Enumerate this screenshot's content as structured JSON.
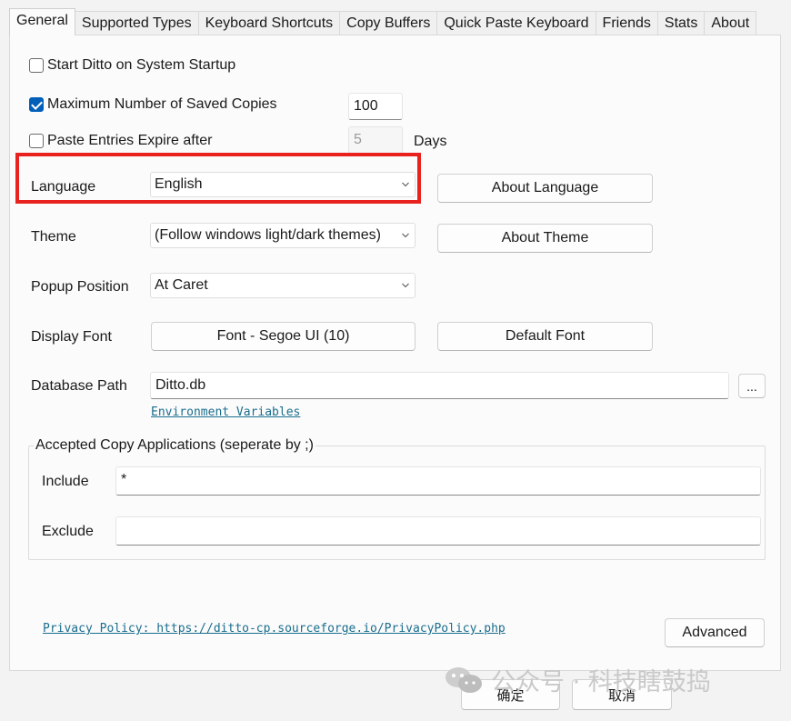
{
  "tabs": [
    {
      "label": "General",
      "active": true
    },
    {
      "label": "Supported Types"
    },
    {
      "label": "Keyboard Shortcuts"
    },
    {
      "label": "Copy Buffers"
    },
    {
      "label": "Quick Paste Keyboard"
    },
    {
      "label": "Friends"
    },
    {
      "label": "Stats"
    },
    {
      "label": "About"
    }
  ],
  "general": {
    "start_on_startup": {
      "label": "Start Ditto on System Startup",
      "checked": false
    },
    "max_saved": {
      "label": "Maximum Number of Saved Copies",
      "checked": true,
      "value": "100"
    },
    "expire": {
      "label": "Paste Entries Expire after",
      "checked": false,
      "value": "5",
      "unit": "Days"
    },
    "language": {
      "label": "Language",
      "value": "English",
      "about_button": "About Language"
    },
    "theme": {
      "label": "Theme",
      "value": "(Follow windows light/dark themes)",
      "about_button": "About Theme"
    },
    "popup_position": {
      "label": "Popup Position",
      "value": "At Caret"
    },
    "display_font": {
      "label": "Display Font",
      "font_button": "Font - Segoe UI (10)",
      "default_button": "Default Font"
    },
    "database_path": {
      "label": "Database Path",
      "value": "Ditto.db",
      "browse_button": "...",
      "env_link": "Environment Variables"
    },
    "accepted_apps": {
      "title": "Accepted Copy Applications (seperate by ;)",
      "include_label": "Include",
      "include_value": "*",
      "exclude_label": "Exclude",
      "exclude_value": ""
    },
    "privacy_link": "Privacy Policy: https://ditto-cp.sourceforge.io/PrivacyPolicy.php",
    "advanced_button": "Advanced"
  },
  "footer": {
    "ok_button": "确定",
    "cancel_button": "取消"
  },
  "watermark": {
    "text": "公众号 · 科技瞎鼓捣",
    "icon": "wechat-icon"
  },
  "colors": {
    "accent": "#005fb8",
    "highlight": "#e8231f",
    "link": "#1a6e8e"
  }
}
